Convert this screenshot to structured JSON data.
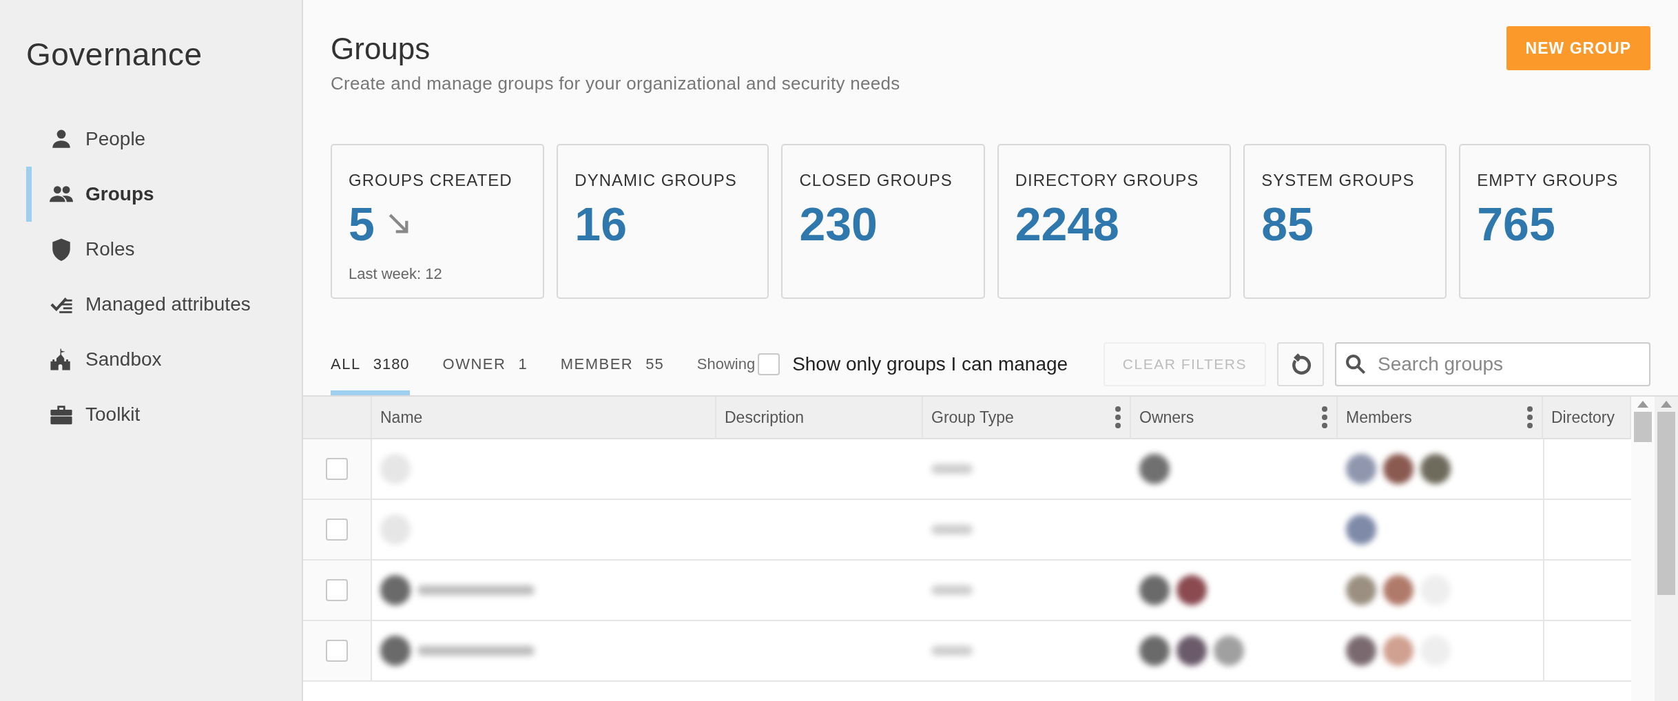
{
  "sidebar": {
    "title": "Governance",
    "items": [
      {
        "label": "People",
        "selected": false
      },
      {
        "label": "Groups",
        "selected": true
      },
      {
        "label": "Roles",
        "selected": false
      },
      {
        "label": "Managed attributes",
        "selected": false
      },
      {
        "label": "Sandbox",
        "selected": false
      },
      {
        "label": "Toolkit",
        "selected": false
      }
    ]
  },
  "header": {
    "title": "Groups",
    "subtitle": "Create and manage groups for your organizational and security needs",
    "button": "NEW GROUP"
  },
  "stats": [
    {
      "label": "GROUPS CREATED",
      "value": "5",
      "kind": "trend",
      "note": "Last week: 12"
    },
    {
      "label": "DYNAMIC GROUPS",
      "value": "16"
    },
    {
      "label": "CLOSED GROUPS",
      "value": "230"
    },
    {
      "label": "DIRECTORY GROUPS",
      "value": "2248"
    },
    {
      "label": "SYSTEM GROUPS",
      "value": "85"
    },
    {
      "label": "EMPTY GROUPS",
      "value": "765"
    }
  ],
  "tabs": [
    {
      "label": "ALL",
      "count": "3180",
      "selected": true
    },
    {
      "label": "OWNER",
      "count": "1",
      "selected": false
    },
    {
      "label": "MEMBER",
      "count": "55",
      "selected": false
    }
  ],
  "filters": {
    "showing": "Showing",
    "manage_only": {
      "label": "Show only groups I can manage",
      "checked": false
    },
    "clear_button": {
      "label": "CLEAR FILTERS",
      "disabled": true
    },
    "search": {
      "placeholder": "Search groups"
    }
  },
  "table": {
    "columns": [
      {
        "label": "Name",
        "menu": false
      },
      {
        "label": "Description",
        "menu": false
      },
      {
        "label": "Group Type",
        "menu": true
      },
      {
        "label": "Owners",
        "menu": true
      },
      {
        "label": "Members",
        "menu": true
      },
      {
        "label": "Directory",
        "menu": false
      }
    ],
    "rows": [
      {
        "checked": false,
        "kind": "unnamed",
        "name_avatar": {
          "color": "#e6e6e6"
        },
        "owners": [
          {
            "color": "#707070"
          }
        ],
        "members": [
          {
            "color": "#8f96ad"
          },
          {
            "color": "#8a5a50"
          },
          {
            "color": "#6e6a5c"
          }
        ]
      },
      {
        "checked": false,
        "kind": "unnamed",
        "name_avatar": {
          "color": "#e6e6e6"
        },
        "owners": [],
        "members": [
          {
            "color": "#7f8aa8"
          }
        ]
      },
      {
        "checked": false,
        "kind": "named",
        "name_avatar": {
          "color": "#6a6a6a"
        },
        "owners": [
          {
            "color": "#6a6a6a"
          },
          {
            "color": "#8a4a50"
          }
        ],
        "members": [
          {
            "color": "#9a8f80"
          },
          {
            "color": "#b07a6a"
          },
          {
            "color": "#eeeeee"
          }
        ]
      },
      {
        "checked": false,
        "kind": "named",
        "name_avatar": {
          "color": "#6a6a6a"
        },
        "owners": [
          {
            "color": "#6a6a6a"
          },
          {
            "color": "#6a5a6a"
          },
          {
            "color": "#a0a0a0"
          }
        ],
        "members": [
          {
            "color": "#7a6a70"
          },
          {
            "color": "#d0a090"
          },
          {
            "color": "#eeeeee"
          }
        ]
      }
    ]
  }
}
